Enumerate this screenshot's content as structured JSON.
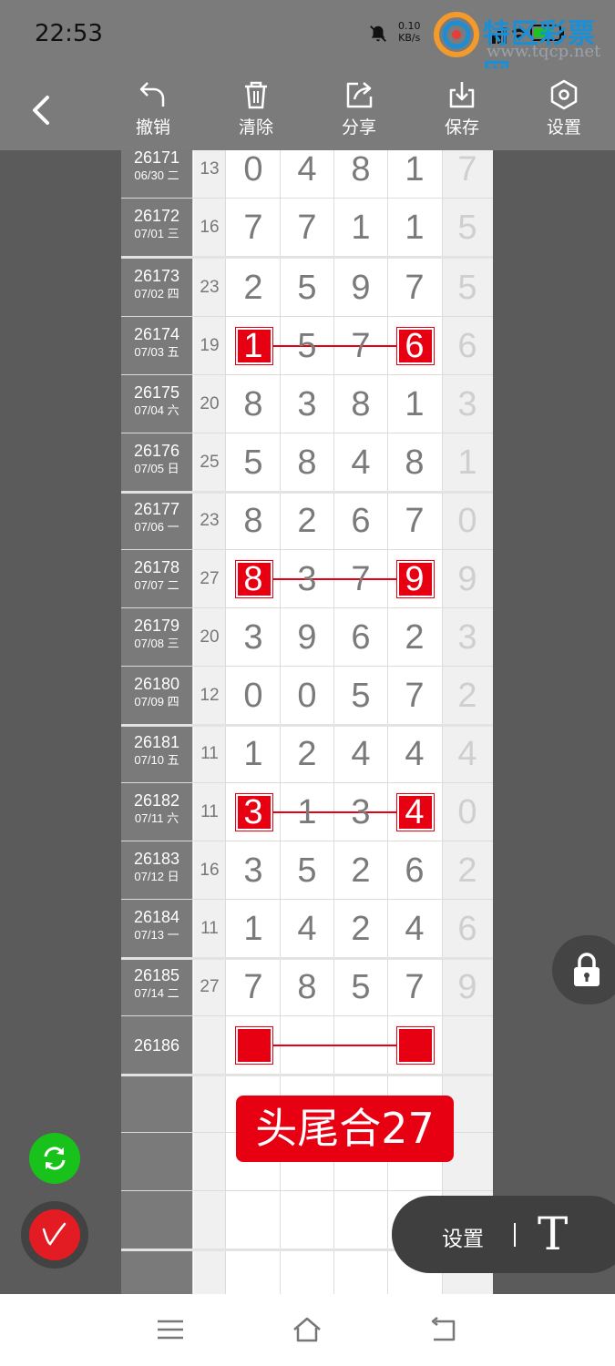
{
  "status_bar": {
    "time": "22:53",
    "speed_value": "0.10",
    "speed_unit": "KB/s",
    "battery_icon": "battery-icon",
    "wifi_icon": "wifi-icon",
    "signal_icon": "signal-icon",
    "mute_icon": "bell-off-icon"
  },
  "watermark": {
    "title": "特区彩票网",
    "url": "www.tqcp.net"
  },
  "toolbar": {
    "back_icon": "chevron-left-icon",
    "items": [
      {
        "label": "撤销",
        "icon": "undo-icon"
      },
      {
        "label": "清除",
        "icon": "trash-icon"
      },
      {
        "label": "分享",
        "icon": "share-icon"
      },
      {
        "label": "保存",
        "icon": "download-icon"
      },
      {
        "label": "设置",
        "icon": "settings-hexagon-icon"
      }
    ]
  },
  "rows": [
    {
      "issue": "26171",
      "date": "06/30 二",
      "sum": "13",
      "digits": [
        "0",
        "4",
        "8",
        "1"
      ],
      "last": "7"
    },
    {
      "issue": "26172",
      "date": "07/01 三",
      "sum": "16",
      "digits": [
        "7",
        "7",
        "1",
        "1"
      ],
      "last": "5"
    },
    {
      "issue": "26173",
      "date": "07/02 四",
      "sum": "23",
      "digits": [
        "2",
        "5",
        "9",
        "7"
      ],
      "last": "5"
    },
    {
      "issue": "26174",
      "date": "07/03 五",
      "sum": "19",
      "digits": [
        "1",
        "5",
        "7",
        "6"
      ],
      "last": "6"
    },
    {
      "issue": "26175",
      "date": "07/04 六",
      "sum": "20",
      "digits": [
        "8",
        "3",
        "8",
        "1"
      ],
      "last": "3"
    },
    {
      "issue": "26176",
      "date": "07/05 日",
      "sum": "25",
      "digits": [
        "5",
        "8",
        "4",
        "8"
      ],
      "last": "1"
    },
    {
      "issue": "26177",
      "date": "07/06 一",
      "sum": "23",
      "digits": [
        "8",
        "2",
        "6",
        "7"
      ],
      "last": "0"
    },
    {
      "issue": "26178",
      "date": "07/07 二",
      "sum": "27",
      "digits": [
        "8",
        "3",
        "7",
        "9"
      ],
      "last": "9"
    },
    {
      "issue": "26179",
      "date": "07/08 三",
      "sum": "20",
      "digits": [
        "3",
        "9",
        "6",
        "2"
      ],
      "last": "3"
    },
    {
      "issue": "26180",
      "date": "07/09 四",
      "sum": "12",
      "digits": [
        "0",
        "0",
        "5",
        "7"
      ],
      "last": "2"
    },
    {
      "issue": "26181",
      "date": "07/10 五",
      "sum": "11",
      "digits": [
        "1",
        "2",
        "4",
        "4"
      ],
      "last": "4"
    },
    {
      "issue": "26182",
      "date": "07/11 六",
      "sum": "11",
      "digits": [
        "3",
        "1",
        "3",
        "4"
      ],
      "last": "0"
    },
    {
      "issue": "26183",
      "date": "07/12 日",
      "sum": "16",
      "digits": [
        "3",
        "5",
        "2",
        "6"
      ],
      "last": "2"
    },
    {
      "issue": "26184",
      "date": "07/13 一",
      "sum": "11",
      "digits": [
        "1",
        "4",
        "2",
        "4"
      ],
      "last": "6"
    },
    {
      "issue": "26185",
      "date": "07/14 二",
      "sum": "27",
      "digits": [
        "7",
        "8",
        "5",
        "7"
      ],
      "last": "9"
    },
    {
      "issue": "26186",
      "date": "",
      "sum": "",
      "digits": [
        "",
        "",
        "",
        ""
      ],
      "last": ""
    },
    {
      "issue": "",
      "date": "",
      "sum": "",
      "digits": [
        "",
        "",
        "",
        ""
      ],
      "last": ""
    },
    {
      "issue": "",
      "date": "",
      "sum": "",
      "digits": [
        "",
        "",
        "",
        ""
      ],
      "last": ""
    },
    {
      "issue": "",
      "date": "",
      "sum": "",
      "digits": [
        "",
        "",
        "",
        ""
      ],
      "last": ""
    },
    {
      "issue": "",
      "date": "",
      "sum": "",
      "digits": [
        "",
        "",
        "",
        ""
      ],
      "last": ""
    }
  ],
  "highlighted_rows": [
    3,
    7,
    11,
    15
  ],
  "highlight_color": "#e60012",
  "banner": {
    "text": "头尾合27"
  },
  "floating": {
    "lock_icon": "lock-icon",
    "settings_label": "设置",
    "text_tool_label": "T",
    "refresh_icon": "refresh-icon",
    "pen_icon": "pen-icon"
  },
  "navbar": {
    "menu_icon": "menu-icon",
    "home_icon": "home-icon",
    "back_icon": "back-icon"
  }
}
